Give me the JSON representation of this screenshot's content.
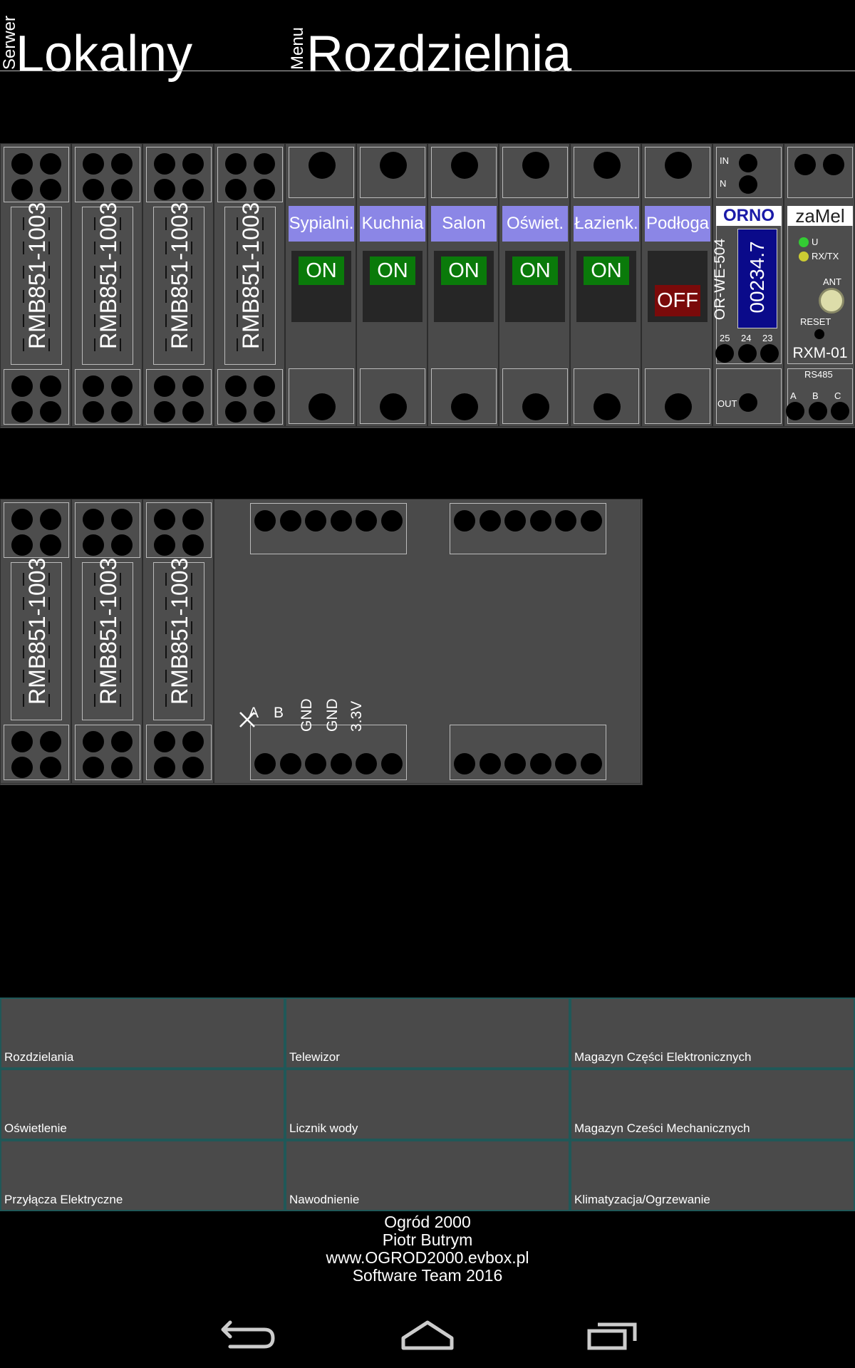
{
  "header": {
    "server_small": "Serwer",
    "server_name": "Lokalny",
    "menu_small": "Menu",
    "menu_name": "Rozdzielnia"
  },
  "relays_top": [
    "RMB851-1003",
    "RMB851-1003",
    "RMB851-1003",
    "RMB851-1003"
  ],
  "switches": [
    {
      "name": "Sypialni.",
      "state": "ON"
    },
    {
      "name": "Kuchnia",
      "state": "ON"
    },
    {
      "name": "Salon",
      "state": "ON"
    },
    {
      "name": "Oświet.",
      "state": "ON"
    },
    {
      "name": "Łazienk.",
      "state": "ON"
    },
    {
      "name": "Podłoga",
      "state": "OFF"
    }
  ],
  "meter": {
    "in_label": "IN",
    "n_label": "N",
    "brand": "ORNO",
    "model": "OR-WE-504",
    "reading": "00234.7",
    "t25": "25",
    "t24": "24",
    "t23": "23",
    "out_label": "OUT"
  },
  "receiver": {
    "brand": "zaMel",
    "u_label": "U",
    "rxtx_label": "RX/TX",
    "ant_label": "ANT",
    "reset_label": "RESET",
    "model": "RXM-01",
    "rs485_label": "RS485",
    "a_label": "A",
    "b_label": "B",
    "c_label": "C"
  },
  "relays_bottom": [
    "RMB851-1003",
    "RMB851-1003",
    "RMB851-1003"
  ],
  "board_pins": [
    "A",
    "B",
    "GND",
    "GND",
    "3.3V"
  ],
  "menu": [
    "Rozdzielania",
    "Telewizor",
    "Magazyn Części Elektronicznych",
    "Oświetlenie",
    "Licznik wody",
    "Magazyn Cześci Mechanicznych",
    "Przyłącza Elektryczne",
    "Nawodnienie",
    "Klimatyzacja/Ogrzewanie"
  ],
  "footer": [
    "Ogród 2000",
    "Piotr Butrym",
    "www.OGROD2000.evbox.pl",
    "Software Team 2016"
  ],
  "colors": {
    "switch_label_bg": "#8b86e6",
    "on_green": "#0a7a0a",
    "off_red": "#7a0a0a",
    "meter_blue": "#0a0a8a",
    "menu_border": "#205858"
  },
  "nav": {
    "back": "back-icon",
    "home": "home-icon",
    "recents": "recents-icon"
  }
}
